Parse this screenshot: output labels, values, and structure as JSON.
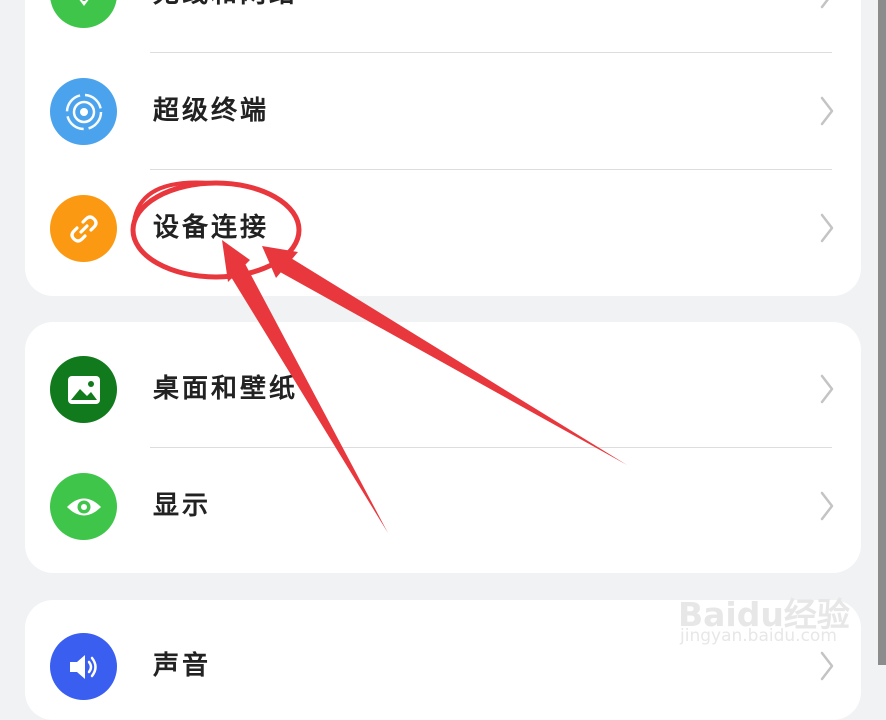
{
  "settings": {
    "group1": {
      "items": [
        {
          "label": "无线和网络",
          "icon": "wifi-icon",
          "color": "#3fc64a"
        },
        {
          "label": "超级终端",
          "icon": "super-device-icon",
          "color": "#3d9ef0"
        },
        {
          "label": "设备连接",
          "icon": "link-icon",
          "color": "#fb9a12"
        }
      ]
    },
    "group2": {
      "items": [
        {
          "label": "桌面和壁纸",
          "icon": "image-icon",
          "color": "#117a1c"
        },
        {
          "label": "显示",
          "icon": "eye-icon",
          "color": "#3fc64a"
        }
      ]
    },
    "group3": {
      "items": [
        {
          "label": "声音",
          "icon": "speaker-icon",
          "color": "#3a5ef0"
        }
      ]
    }
  },
  "annotation": {
    "color": "#e8373d",
    "highlight": "设备连接"
  },
  "watermark": {
    "brand": "Baidu经验",
    "url": "jingyan.baidu.com"
  }
}
